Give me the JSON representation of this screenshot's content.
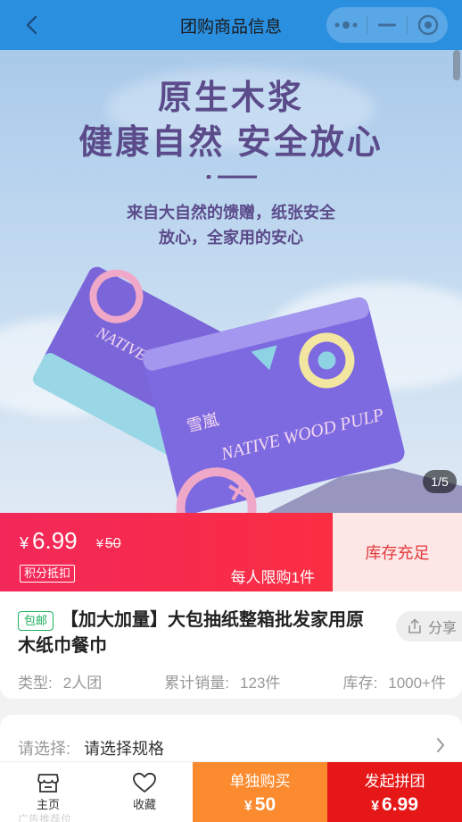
{
  "header": {
    "title": "团购商品信息"
  },
  "hero": {
    "headline_1": "原生木浆",
    "headline_2": "健康自然 安全放心",
    "sub_1": "来自大自然的馈赠，纸张安全",
    "sub_2": "放心，全家用的安心",
    "package_text": "NATIVE WOOD PULP",
    "brand_text": "雪嵐",
    "pager": "1/5"
  },
  "price": {
    "currency": "¥",
    "group_price": "6.99",
    "original_price": "50",
    "points_tag": "积分抵扣",
    "limit_text": "每人限购1件",
    "stock_status": "库存充足"
  },
  "product": {
    "shipping_tag": "包邮",
    "title": "【加大加量】大包抽纸整箱批发家用原木纸巾餐巾",
    "share_label": "分享",
    "type_label": "类型:",
    "type_value": "2人团",
    "sales_label": "累计销量:",
    "sales_value": "123件",
    "stock_label": "库存:",
    "stock_value": "1000+件"
  },
  "spec": {
    "label": "请选择:",
    "value": "请选择规格"
  },
  "bottom_bar": {
    "home_label": "主页",
    "favorite_label": "收藏",
    "solo_label": "单独购买",
    "solo_price": "50",
    "group_label": "发起拼团",
    "group_price": "6.99",
    "ghost_text": "广告推荐位"
  },
  "colors": {
    "header_blue": "#2b8fe0",
    "price_red": "#f3285a",
    "stock_pink": "#fde6e6",
    "solo_orange": "#fb8b2e",
    "group_red": "#e61717",
    "shipping_green": "#19b05a",
    "hero_purple": "#5b4b8a"
  }
}
